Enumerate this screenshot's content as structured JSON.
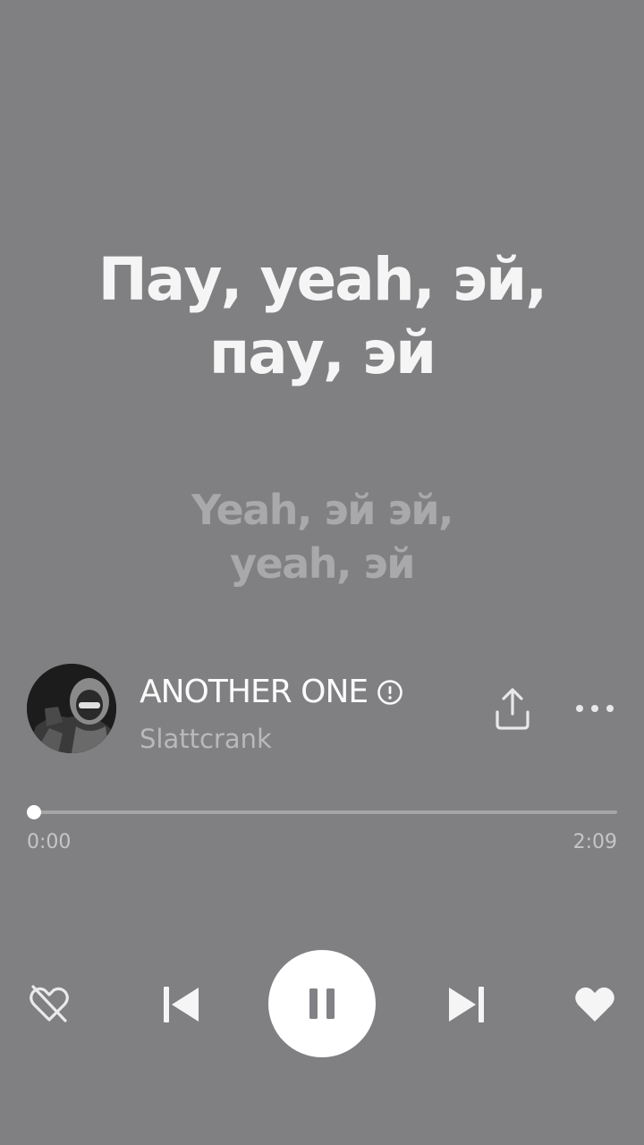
{
  "lyrics": {
    "current_line_1": "Пау, yeah, эй,",
    "current_line_2": "пау, эй",
    "next_line_1": "Yeah, эй эй,",
    "next_line_2": "yeah, эй"
  },
  "track": {
    "title": "ANOTHER ONE",
    "artist": "Slattcrank",
    "explicit_icon": "exclamation-circle-icon"
  },
  "progress": {
    "current_time": "0:00",
    "total_time": "2:09",
    "fraction": 0.0
  },
  "actions": {
    "share_icon": "share-icon",
    "more_icon": "more-dots-icon"
  },
  "controls": {
    "dislike_icon": "broken-heart-icon",
    "prev_icon": "skip-previous-icon",
    "play_state_icon": "pause-icon",
    "next_icon": "skip-next-icon",
    "like_icon": "heart-icon"
  },
  "colors": {
    "background": "#807f82",
    "primary_text": "#fafafa",
    "secondary_text": "#b9b8bb"
  }
}
